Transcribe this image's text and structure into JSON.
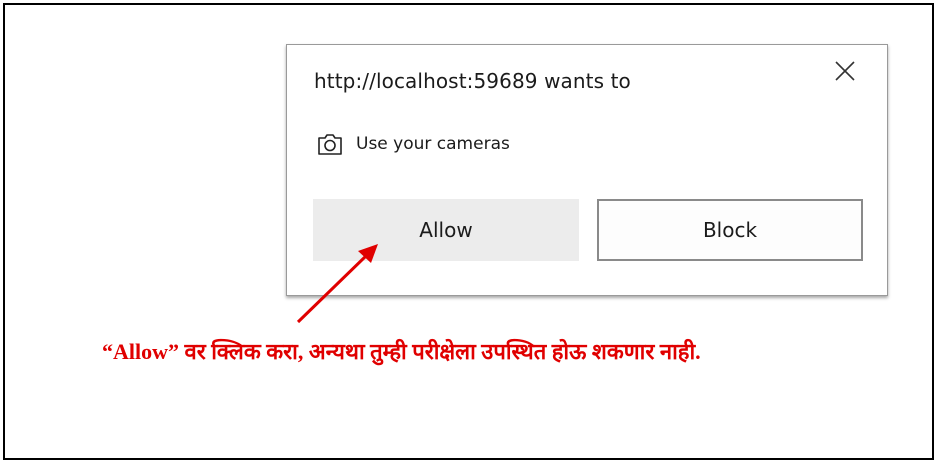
{
  "dialog": {
    "title": "http://localhost:59689 wants to",
    "close_icon": "close-icon",
    "permission": {
      "icon": "camera-icon",
      "label": "Use your cameras"
    },
    "buttons": {
      "allow_label": "Allow",
      "block_label": "Block"
    }
  },
  "annotation": {
    "text": "“Allow” वर क्लिक करा, अन्यथा तुम्ही परीक्षेला उपस्थित होऊ शकणार नाही.",
    "color": "#e00000",
    "arrow_icon": "arrow-icon"
  },
  "colors": {
    "allow_bg": "#ececec",
    "block_border": "#8a8a8a",
    "annotation": "#e00000"
  }
}
